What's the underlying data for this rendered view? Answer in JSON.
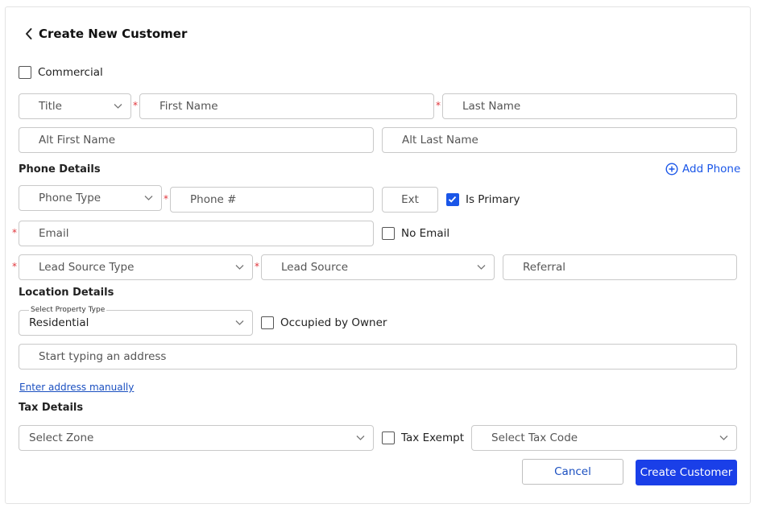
{
  "header": {
    "title": "Create New Customer"
  },
  "commercial": {
    "label": "Commercial",
    "checked": false
  },
  "name": {
    "title_placeholder": "Title",
    "first_name_placeholder": "First Name",
    "last_name_placeholder": "Last Name",
    "alt_first_name_placeholder": "Alt First Name",
    "alt_last_name_placeholder": "Alt Last Name",
    "required_mark": "*"
  },
  "phone": {
    "section_title": "Phone Details",
    "add_phone_label": "Add Phone",
    "phone_type_placeholder": "Phone Type",
    "phone_number_placeholder": "Phone #",
    "ext_placeholder": "Ext",
    "is_primary_label": "Is Primary",
    "is_primary_checked": true
  },
  "email": {
    "placeholder": "Email",
    "no_email_label": "No Email",
    "no_email_checked": false
  },
  "lead": {
    "lead_source_type_placeholder": "Lead Source Type",
    "lead_source_placeholder": "Lead Source",
    "referral_placeholder": "Referral"
  },
  "location": {
    "section_title": "Location Details",
    "property_type_label": "Select Property Type",
    "property_type_value": "Residential",
    "occupied_by_owner_label": "Occupied by Owner",
    "occupied_by_owner_checked": false,
    "address_placeholder": "Start typing an address",
    "enter_manually_link": "Enter address manually"
  },
  "tax": {
    "section_title": "Tax Details",
    "zone_placeholder": "Select Zone",
    "tax_exempt_label": "Tax Exempt",
    "tax_exempt_checked": false,
    "tax_code_placeholder": "Select Tax Code"
  },
  "actions": {
    "cancel_label": "Cancel",
    "create_label": "Create Customer"
  },
  "colors": {
    "primary": "#1a3fe8",
    "link": "#1a4fc0",
    "required": "#e0353b",
    "border": "#c9c9c9"
  },
  "icons": {
    "back": "chevron-left-icon",
    "dropdown": "chevron-down-icon",
    "add": "plus-circle-icon",
    "check": "check-icon"
  }
}
